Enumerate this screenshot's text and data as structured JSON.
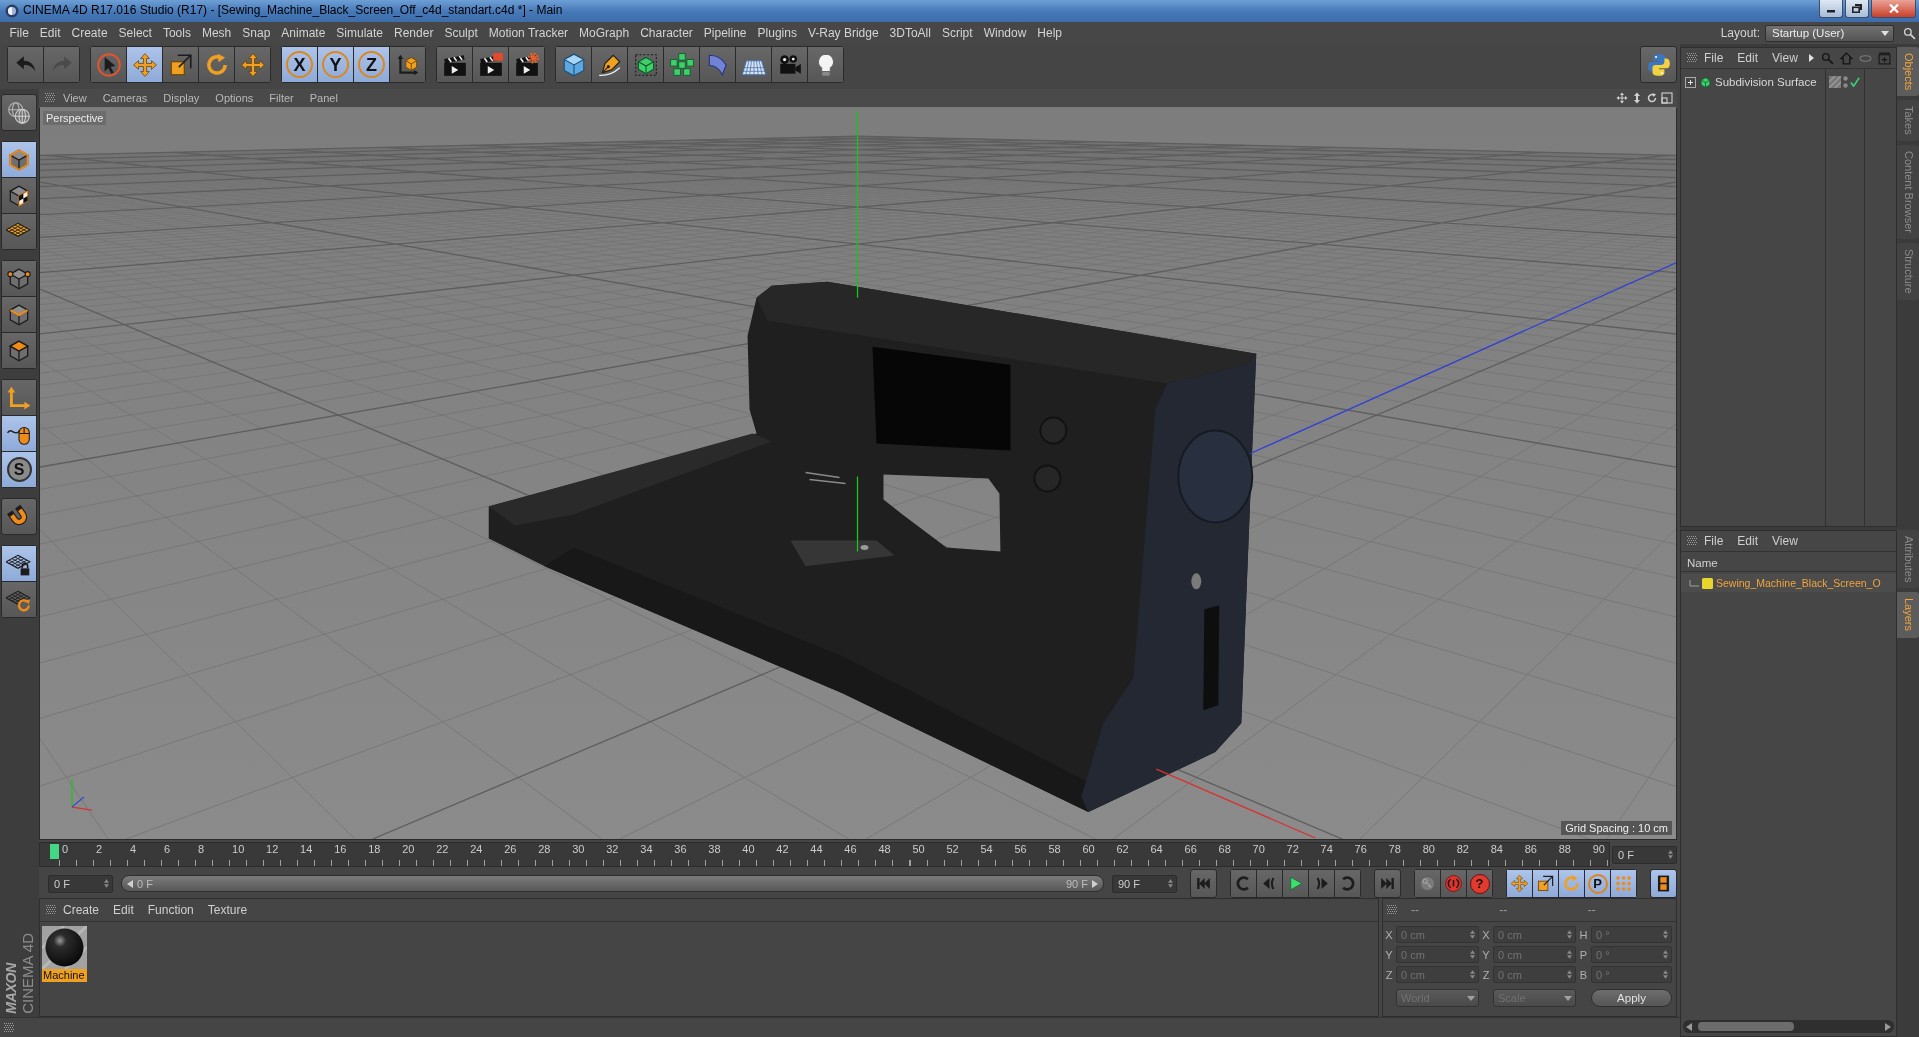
{
  "window": {
    "title": "CINEMA 4D R17.016 Studio (R17) - [Sewing_Machine_Black_Screen_Off_c4d_standart.c4d *] - Main"
  },
  "menu_bar": {
    "items": [
      "File",
      "Edit",
      "Create",
      "Select",
      "Tools",
      "Mesh",
      "Snap",
      "Animate",
      "Simulate",
      "Render",
      "Sculpt",
      "Motion Tracker",
      "MoGraph",
      "Character",
      "Pipeline",
      "Plugins",
      "V-Ray Bridge",
      "3DToAll",
      "Script",
      "Window",
      "Help"
    ],
    "layout_label": "Layout:",
    "layout_value": "Startup (User)"
  },
  "toolbar": {
    "groups": [
      {
        "buttons": [
          {
            "kind": "undo",
            "selected": false,
            "disabled": false
          },
          {
            "kind": "redo",
            "selected": false,
            "disabled": true
          }
        ]
      },
      {
        "buttons": [
          {
            "kind": "live_select",
            "selected": false
          },
          {
            "kind": "move",
            "selected": true
          },
          {
            "kind": "scale",
            "selected": false
          },
          {
            "kind": "rotate",
            "selected": false
          },
          {
            "kind": "recent_tool",
            "selected": false
          }
        ]
      },
      {
        "buttons": [
          {
            "kind": "axis_lock",
            "label": "X",
            "selected": true
          },
          {
            "kind": "axis_lock",
            "label": "Y",
            "selected": true
          },
          {
            "kind": "axis_lock",
            "label": "Z",
            "selected": true
          },
          {
            "kind": "coordinate_system",
            "selected": false
          }
        ]
      },
      {
        "buttons": [
          {
            "kind": "render_view",
            "selected": false
          },
          {
            "kind": "render_picture_viewer",
            "selected": false
          },
          {
            "kind": "render_settings",
            "selected": false
          }
        ]
      },
      {
        "buttons": [
          {
            "kind": "cube",
            "selected": false
          },
          {
            "kind": "pen",
            "selected": false
          },
          {
            "kind": "subdivision_surface",
            "selected": false
          },
          {
            "kind": "cloner",
            "selected": false
          },
          {
            "kind": "bend",
            "selected": false
          },
          {
            "kind": "floor",
            "selected": false
          },
          {
            "kind": "camera",
            "selected": false
          },
          {
            "kind": "light",
            "selected": false
          }
        ]
      },
      {
        "buttons": [
          {
            "kind": "python",
            "selected": false
          }
        ]
      }
    ]
  },
  "mode_toolbar": {
    "groups": [
      {
        "buttons": [
          {
            "kind": "make_editable",
            "selected": false
          }
        ]
      },
      {
        "buttons": [
          {
            "kind": "model_mode",
            "selected": true
          },
          {
            "kind": "texture_mode",
            "selected": false
          },
          {
            "kind": "workplane_mode",
            "selected": false
          }
        ]
      },
      {
        "buttons": [
          {
            "kind": "points_mode",
            "selected": false
          },
          {
            "kind": "edges_mode",
            "selected": false
          },
          {
            "kind": "polygons_mode",
            "selected": false
          }
        ]
      },
      {
        "buttons": [
          {
            "kind": "axis_mode",
            "selected": false
          },
          {
            "kind": "tweak_mode",
            "selected": true
          },
          {
            "kind": "snapping",
            "label": "S",
            "selected": true
          }
        ]
      },
      {
        "buttons": [
          {
            "kind": "magnet",
            "selected": false
          }
        ]
      },
      {
        "buttons": [
          {
            "kind": "workplane_lock",
            "selected": true
          },
          {
            "kind": "workplane_align",
            "selected": false
          }
        ]
      }
    ]
  },
  "viewport": {
    "menu": [
      "View",
      "Cameras",
      "Display",
      "Options",
      "Filter",
      "Panel"
    ],
    "camera": "Perspective",
    "grid_spacing": "Grid Spacing : 10 cm"
  },
  "timeline": {
    "ticks": [
      "0",
      "2",
      "4",
      "6",
      "8",
      "10",
      "12",
      "14",
      "16",
      "18",
      "20",
      "22",
      "24",
      "26",
      "28",
      "30",
      "32",
      "34",
      "36",
      "38",
      "40",
      "42",
      "44",
      "46",
      "48",
      "50",
      "52",
      "54",
      "56",
      "58",
      "60",
      "62",
      "64",
      "66",
      "68",
      "70",
      "72",
      "74",
      "76",
      "78",
      "80",
      "82",
      "84",
      "86",
      "88",
      "90"
    ],
    "playhead": {
      "level": 0
    },
    "current_frame": "0 F",
    "start_frame": "0 F",
    "range": {
      "start": "0 F",
      "end": "90 F"
    },
    "end_frame": "90 F",
    "groups": [
      {
        "buttons": [
          {
            "kind": "goto_start",
            "selected": false
          }
        ]
      },
      {
        "buttons": [
          {
            "kind": "previous_key",
            "selected": false
          },
          {
            "kind": "step_back",
            "selected": false
          },
          {
            "kind": "play",
            "selected": false
          },
          {
            "kind": "step_forward",
            "selected": false
          },
          {
            "kind": "next_key",
            "selected": false
          }
        ]
      },
      {
        "buttons": [
          {
            "kind": "goto_end",
            "selected": false
          }
        ]
      },
      {
        "buttons": [
          {
            "kind": "record",
            "selected": false
          },
          {
            "kind": "auto_key",
            "selected": false
          },
          {
            "kind": "key_selection",
            "label": "?",
            "selected": false
          }
        ]
      },
      {
        "buttons": [
          {
            "kind": "key_position",
            "selected": true
          },
          {
            "kind": "key_scale",
            "selected": true
          },
          {
            "kind": "key_rotation",
            "selected": true
          },
          {
            "kind": "key_parameter",
            "label": "P",
            "selected": true
          },
          {
            "kind": "key_point_level",
            "selected": true
          }
        ]
      },
      {
        "buttons": [
          {
            "kind": "timeline_window",
            "selected": true
          }
        ]
      }
    ]
  },
  "material_manager": {
    "menu": [
      "Create",
      "Edit",
      "Function",
      "Texture"
    ],
    "materials": [
      {
        "name": "Machine",
        "selected": true
      }
    ]
  },
  "coordinates": {
    "headers": [
      "--",
      "--",
      "--"
    ],
    "rows": [
      [
        {
          "axis": "X",
          "value": "0 cm",
          "disabled": true
        },
        {
          "axis": "X",
          "value": "0 cm",
          "disabled": true
        },
        {
          "axis": "H",
          "value": "0 °",
          "disabled": true
        }
      ],
      [
        {
          "axis": "Y",
          "value": "0 cm",
          "disabled": true
        },
        {
          "axis": "Y",
          "value": "0 cm",
          "disabled": true
        },
        {
          "axis": "P",
          "value": "0 °",
          "disabled": true
        }
      ],
      [
        {
          "axis": "Z",
          "value": "0 cm",
          "disabled": true
        },
        {
          "axis": "Z",
          "value": "0 cm",
          "disabled": true
        },
        {
          "axis": "B",
          "value": "0 °",
          "disabled": true
        }
      ]
    ],
    "dropdowns": [
      {
        "value": "World",
        "disabled": true
      },
      {
        "value": "Scale",
        "disabled": true
      }
    ],
    "apply": "Apply"
  },
  "object_manager": {
    "menu": [
      "File",
      "Edit",
      "View"
    ],
    "objects": [
      {
        "name": "Subdivision Surface",
        "expanded": false,
        "enabled": true,
        "selected": false
      }
    ]
  },
  "layer_manager": {
    "menu": [
      "File",
      "Edit",
      "View"
    ],
    "column": "Name",
    "layers": [
      {
        "name": "Sewing_Machine_Black_Screen_O",
        "color": "#e8d62c",
        "selected": true
      }
    ]
  },
  "side_tabs": {
    "upper": [
      {
        "label": "Objects",
        "selected": true
      },
      {
        "label": "Takes",
        "selected": false
      },
      {
        "label": "Content Browser",
        "selected": false
      },
      {
        "label": "Structure",
        "selected": false
      }
    ],
    "lower": [
      {
        "label": "Attributes",
        "selected": false
      },
      {
        "label": "Layers",
        "selected": true
      }
    ]
  },
  "logo": {
    "brand": "MAXON",
    "product": "CINEMA 4D"
  }
}
